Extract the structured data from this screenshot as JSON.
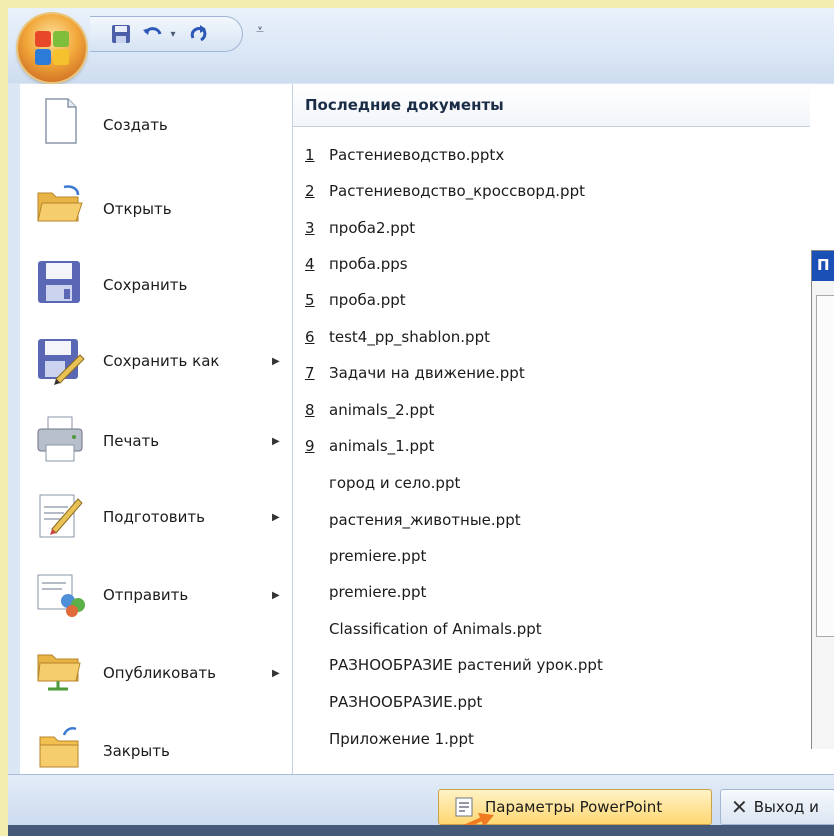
{
  "colors": {
    "accent": "#f2a83a",
    "header_text": "#1a2c46",
    "selected_button": "#ffd772",
    "status_strip": "#445a78"
  },
  "quick_access": {
    "icons": [
      "save-icon",
      "undo-icon",
      "redo-icon",
      "customize-icon"
    ]
  },
  "menu": {
    "items": [
      {
        "label": "Создать",
        "icon": "new-document-icon",
        "has_submenu": false
      },
      {
        "label": "Открыть",
        "icon": "open-folder-icon",
        "has_submenu": false
      },
      {
        "label": "Сохранить",
        "icon": "save-disk-icon",
        "has_submenu": false
      },
      {
        "label": "Сохранить как",
        "icon": "save-as-icon",
        "has_submenu": true
      },
      {
        "label": "Печать",
        "icon": "printer-icon",
        "has_submenu": true
      },
      {
        "label": "Подготовить",
        "icon": "prepare-pencil-icon",
        "has_submenu": true
      },
      {
        "label": "Отправить",
        "icon": "send-icon",
        "has_submenu": true
      },
      {
        "label": "Опубликовать",
        "icon": "publish-folder-icon",
        "has_submenu": true
      },
      {
        "label": "Закрыть",
        "icon": "close-folder-icon",
        "has_submenu": false
      }
    ]
  },
  "recent": {
    "title": "Последние документы",
    "items": [
      {
        "num": "1",
        "name": "Растениеводство.pptx"
      },
      {
        "num": "2",
        "name": "Растениеводство_кроссворд.ppt"
      },
      {
        "num": "3",
        "name": "проба2.ppt"
      },
      {
        "num": "4",
        "name": "проба.pps"
      },
      {
        "num": "5",
        "name": "проба.ppt"
      },
      {
        "num": "6",
        "name": "test4_pp_shablon.ppt"
      },
      {
        "num": "7",
        "name": "Задачи на движение.ppt"
      },
      {
        "num": "8",
        "name": "animals_2.ppt"
      },
      {
        "num": "9",
        "name": "animals_1.ppt"
      },
      {
        "num": "",
        "name": "город и село.ppt"
      },
      {
        "num": "",
        "name": "растения_животные.ppt"
      },
      {
        "num": "",
        "name": "premiere.ppt"
      },
      {
        "num": "",
        "name": "premiere.ppt"
      },
      {
        "num": "",
        "name": "Classification of Animals.ppt"
      },
      {
        "num": "",
        "name": "РАЗНООБРАЗИЕ растений урок.ppt"
      },
      {
        "num": "",
        "name": "РАЗНООБРАЗИЕ.ppt"
      },
      {
        "num": "",
        "name": "Приложение 1.ppt"
      }
    ]
  },
  "peek_window": {
    "title": "П"
  },
  "bottom": {
    "options_label": "Параметры PowerPoint",
    "exit_label": "Выход и"
  }
}
